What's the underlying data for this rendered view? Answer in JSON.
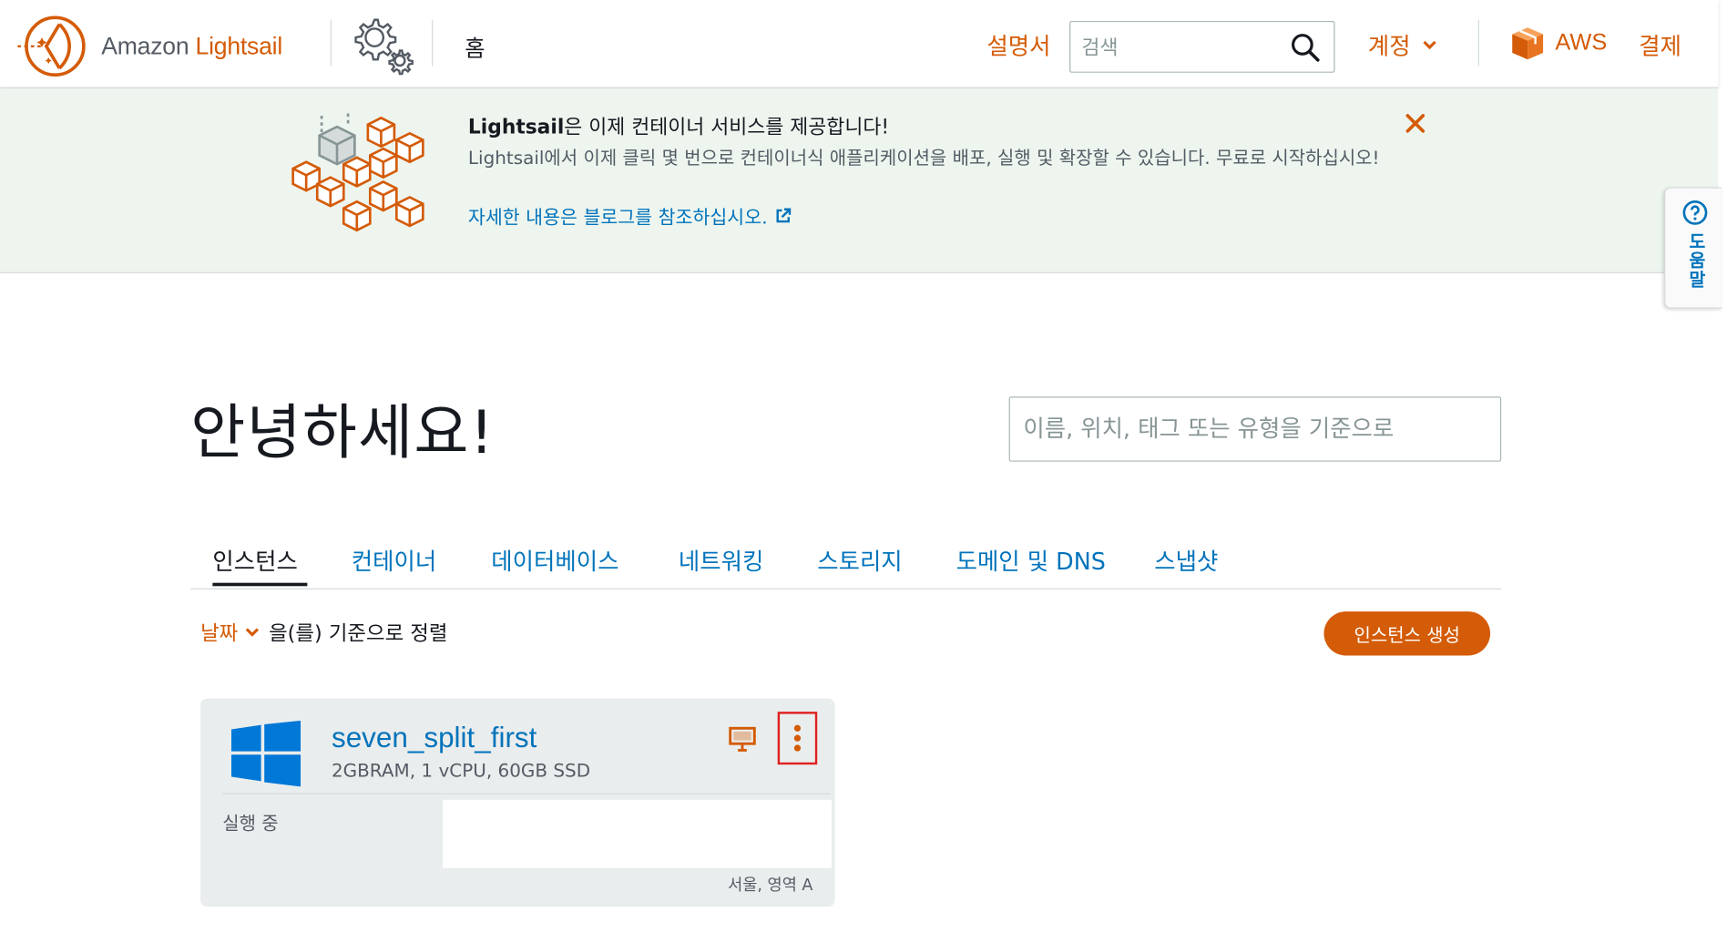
{
  "header": {
    "logo_prefix": "Amazon",
    "logo_brand": "Lightsail",
    "home_label": "홈",
    "docs_label": "설명서",
    "search_placeholder": "검색",
    "account_label": "계정",
    "aws_label": "AWS",
    "billing_label": "결제"
  },
  "banner": {
    "title_brand": "Lightsail",
    "title_rest": "은 이제 컨테이너 서비스를 제공합니다!",
    "body": "Lightsail에서 이제 클릭 몇 번으로 컨테이너식 애플리케이션을 배포, 실행 및 확장할 수 있습니다. 무료로 시작하십시오!",
    "link_label": "자세한 내용은 블로그를 참조하십시오."
  },
  "help_tab": {
    "label": "도움말"
  },
  "greeting": "안녕하세요!",
  "filter_placeholder": "이름, 위치, 태그 또는 유형을 기준으로",
  "tabs": [
    {
      "label": "인스턴스",
      "active": true
    },
    {
      "label": "컨테이너"
    },
    {
      "label": "데이터베이스"
    },
    {
      "label": "네트워킹"
    },
    {
      "label": "스토리지"
    },
    {
      "label": "도메인 및 DNS"
    },
    {
      "label": "스냅샷"
    }
  ],
  "sort": {
    "key": "날짜",
    "suffix": "을(를) 기준으로 정렬"
  },
  "create_button_label": "인스턴스 생성",
  "instance": {
    "name": "seven_split_first",
    "spec": "2GBRAM, 1 vCPU, 60GB SSD",
    "status": "실행 중",
    "region": "서울, 영역 A",
    "os_icon": "windows-logo-icon",
    "connect_icon": "monitor-icon",
    "menu_icon": "kebab-menu-icon"
  },
  "colors": {
    "brand_orange": "#d45b07",
    "link_blue": "#0073bb",
    "windows_blue": "#0078d7",
    "banner_bg": "#eef5ef",
    "highlight_red": "#e02020"
  }
}
